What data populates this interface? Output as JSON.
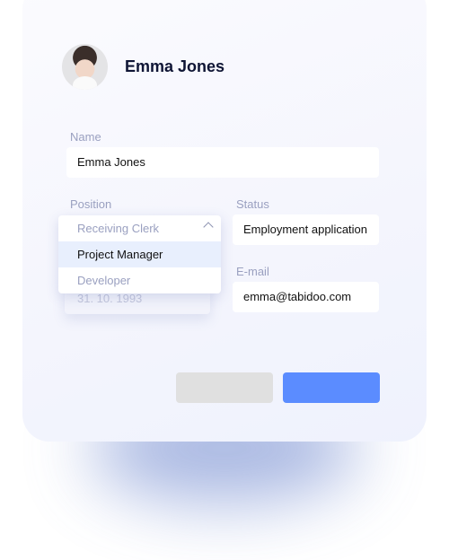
{
  "profile": {
    "name": "Emma Jones"
  },
  "form": {
    "name_label": "Name",
    "name_value": "Emma Jones",
    "position_label": "Position",
    "position_options": [
      "Receiving Clerk",
      "Project Manager",
      "Developer"
    ],
    "position_highlighted": "Project Manager",
    "date_value": "31. 10. 1993",
    "status_label": "Status",
    "status_value": "Employment application",
    "email_label": "E-mail",
    "email_value": "emma@tabidoo.com"
  },
  "colors": {
    "primary": "#5b8cff",
    "secondary": "#e0e0e0"
  }
}
